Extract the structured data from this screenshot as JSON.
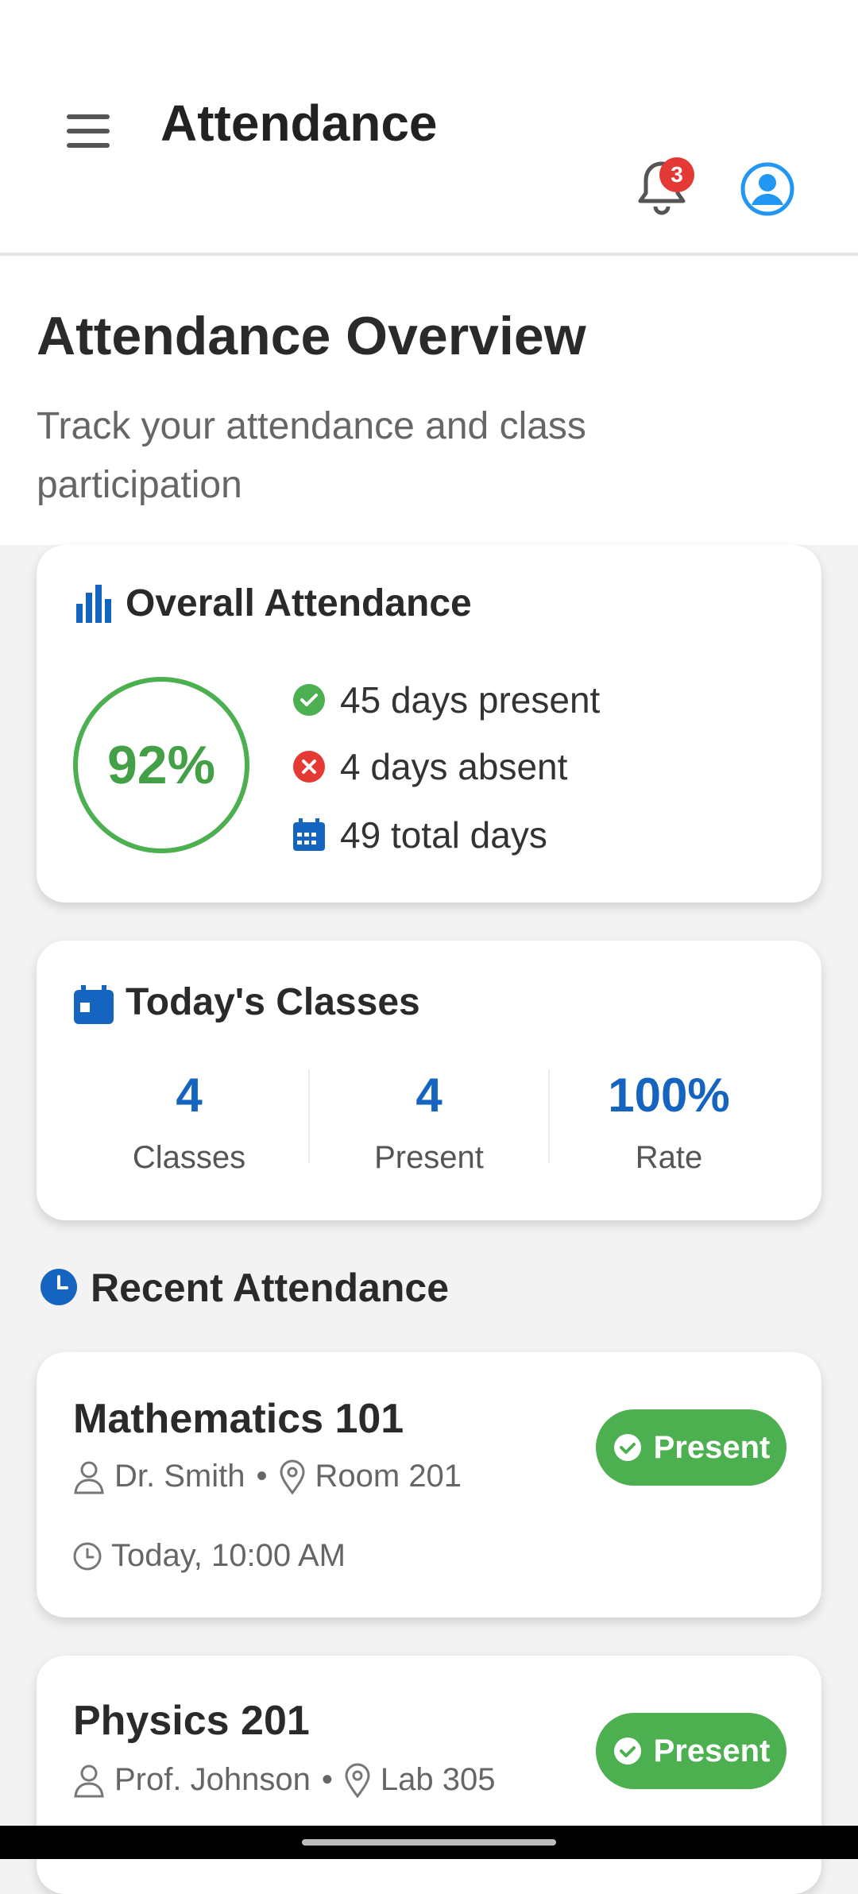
{
  "app_bar": {
    "title": "Attendance",
    "notification_count": "3"
  },
  "hero": {
    "title": "Attendance Overview",
    "subtitle": "Track your attendance and class participation"
  },
  "overall": {
    "title": "Overall Attendance",
    "percent": "92%",
    "present": "45 days present",
    "absent": "4 days absent",
    "total": "49 total days"
  },
  "today": {
    "title": "Today's Classes",
    "metrics": [
      {
        "value": "4",
        "label": "Classes"
      },
      {
        "value": "4",
        "label": "Present"
      },
      {
        "value": "100%",
        "label": "Rate"
      }
    ]
  },
  "recent": {
    "title": "Recent Attendance",
    "items": [
      {
        "name": "Mathematics 101",
        "instructor": "Dr. Smith",
        "room": "Room 201",
        "time": "Today, 10:00 AM",
        "status": "Present"
      },
      {
        "name": "Physics 201",
        "instructor": "Prof. Johnson",
        "room": "Lab 305",
        "status": "Present"
      }
    ]
  },
  "colors": {
    "accent": "#1565c0",
    "success": "#4caf50",
    "danger": "#e53935"
  }
}
